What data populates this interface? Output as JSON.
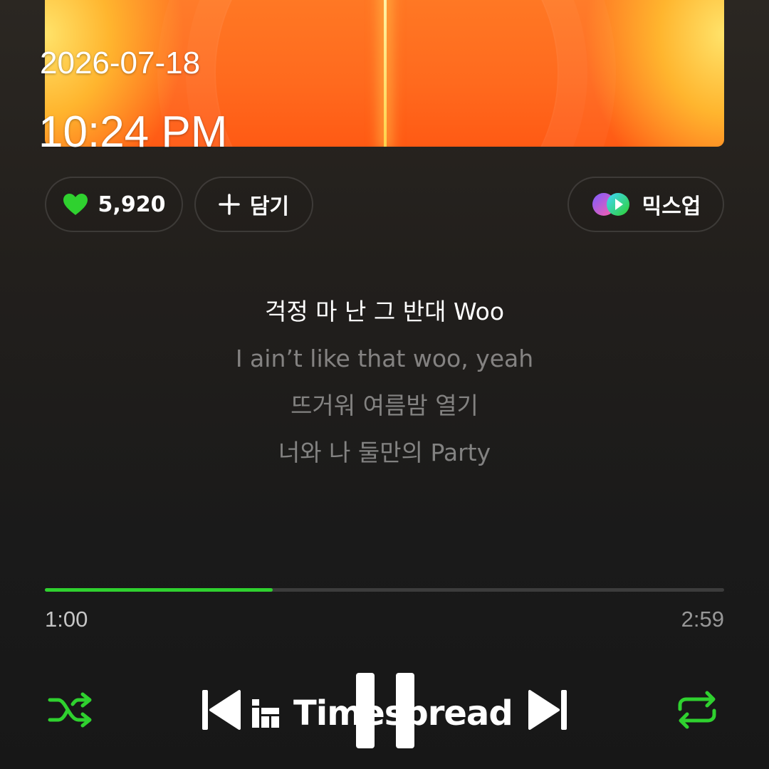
{
  "overlay": {
    "date": "2026-07-18",
    "time": "10:24 PM"
  },
  "actions": {
    "like_count": "5,920",
    "add_label": "담기",
    "mixup_label": "믹스업"
  },
  "lyrics": {
    "lines": [
      "걱정 마 난 그 반대 Woo",
      "I ain’t like that woo, yeah",
      "뜨거워 여름밤 열기",
      "너와 나 둘만의 Party"
    ],
    "current_index": 0
  },
  "playback": {
    "elapsed": "1:00",
    "total": "2:59",
    "progress": 0.335,
    "state": "playing",
    "shuffle": true,
    "repeat": true
  },
  "watermark": {
    "text": "Timespread"
  },
  "colors": {
    "accent": "#2fd12f",
    "album_primary": "#ff6a1e",
    "album_highlight": "#ffe36a"
  },
  "icons": {
    "like": "heart-icon",
    "add": "plus-icon",
    "mixup": "mixup-icon",
    "shuffle": "shuffle-icon",
    "previous": "skip-previous-icon",
    "pause": "pause-icon",
    "next": "skip-next-icon",
    "repeat": "repeat-icon"
  }
}
